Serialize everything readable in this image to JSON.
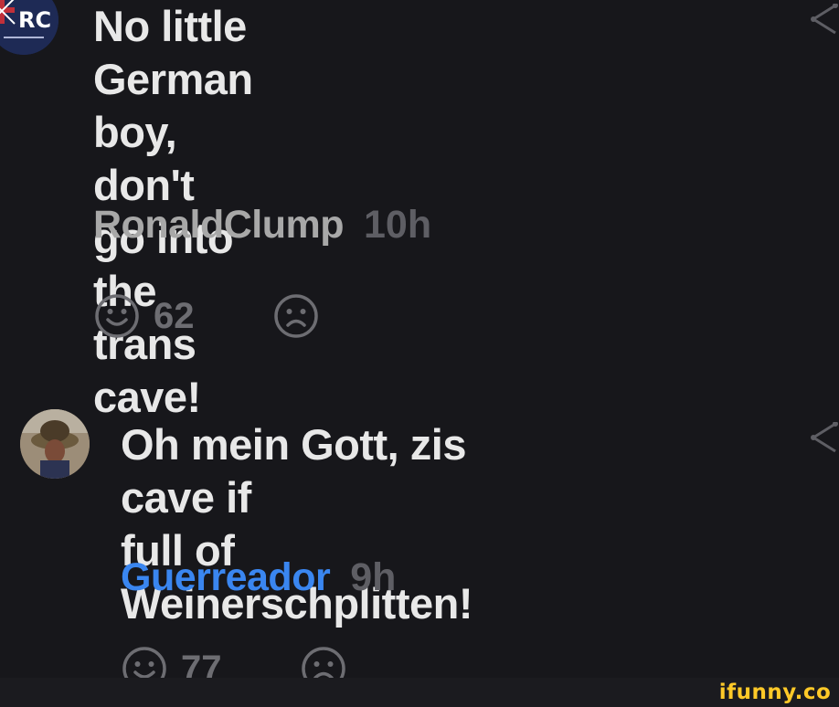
{
  "comments": [
    {
      "avatar_label": "RC",
      "text": "No little German boy,\ndon't go into the trans\ncave!",
      "username": "RonaldClump",
      "time": "10h",
      "likes": "62",
      "like_icon": "smile-icon",
      "dislike_icon": "frown-icon"
    },
    {
      "text": "Oh mein Gott, zis cave if\nfull of Weinerschplitten!",
      "username": "Guerreador",
      "time": "9h",
      "likes": "77",
      "like_icon": "smile-icon",
      "dislike_icon": "frown-icon"
    }
  ],
  "watermark": "ifunny.co",
  "colors": {
    "background": "#17171b",
    "text": "#e8e8e8",
    "username_gray": "#a8a8a8",
    "username_blue": "#3a86f0",
    "time": "#5e5e64",
    "icon": "#6d6d72",
    "watermark": "#ffc928"
  }
}
